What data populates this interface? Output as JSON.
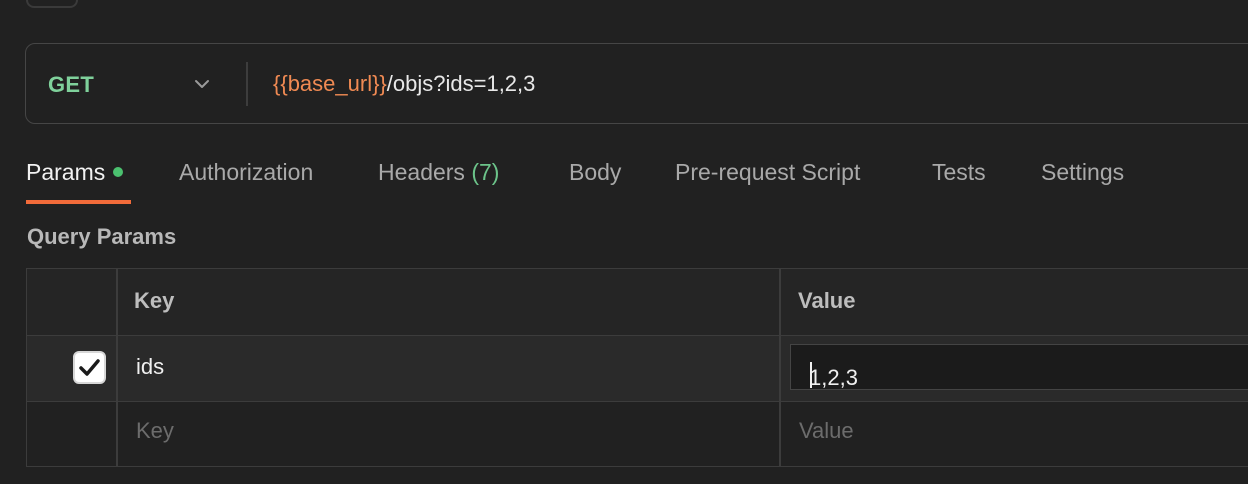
{
  "request": {
    "method": "GET",
    "url_variable": "{{base_url}}",
    "url_path": "/objs?ids=1,2,3"
  },
  "tabs": [
    {
      "label": "Params",
      "active": true,
      "has_indicator": true
    },
    {
      "label": "Authorization"
    },
    {
      "label": "Headers",
      "count": "(7)"
    },
    {
      "label": "Body"
    },
    {
      "label": "Pre-request Script"
    },
    {
      "label": "Tests"
    },
    {
      "label": "Settings"
    }
  ],
  "query_params": {
    "title": "Query Params",
    "columns": {
      "key": "Key",
      "value": "Value"
    },
    "rows": [
      {
        "enabled": true,
        "key": "ids",
        "value": "1,2,3"
      }
    ],
    "placeholder": {
      "key": "Key",
      "value": "Value"
    }
  },
  "colors": {
    "method": "#7fd19b",
    "variable": "#f08a53",
    "active_tab_underline": "#f26b3a",
    "indicator_dot": "#4bc16f",
    "count": "#6cc48a"
  },
  "icons": {
    "method_dropdown": "chevron-down-icon",
    "checkbox": "checkmark-icon"
  }
}
